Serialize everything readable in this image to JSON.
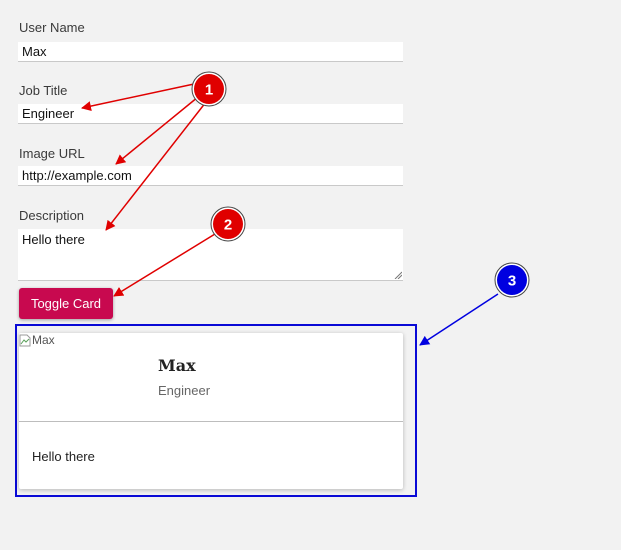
{
  "form": {
    "username": {
      "label": "User Name",
      "value": "Max"
    },
    "job_title": {
      "label": "Job Title",
      "value": "Engineer"
    },
    "image_url": {
      "label": "Image URL",
      "value": "http://example.com"
    },
    "description": {
      "label": "Description",
      "value": "Hello there"
    },
    "toggle_button": "Toggle Card"
  },
  "card": {
    "image_alt": "Max",
    "name": "Max",
    "title": "Engineer",
    "description": "Hello there"
  },
  "annotations": [
    {
      "number": "1",
      "color": "#e00000"
    },
    {
      "number": "2",
      "color": "#e00000"
    },
    {
      "number": "3",
      "color": "#0000e0"
    }
  ]
}
